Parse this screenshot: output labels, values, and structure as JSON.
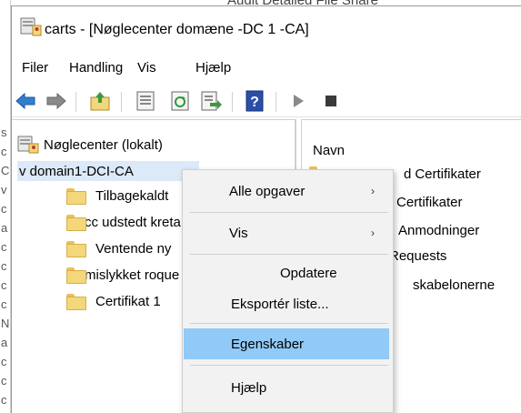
{
  "background": {
    "title_fragment": "Audit Detailed File Share",
    "left_edge_letters": [
      "s",
      "c",
      "C",
      "v",
      "c",
      "a",
      "c",
      "c",
      "c",
      "c",
      "N",
      "a",
      "c",
      "c",
      "c",
      "C"
    ]
  },
  "window": {
    "title": "carts - [Nøglecenter domæne -DC 1 -CA]"
  },
  "menu": {
    "items": [
      "Filer",
      "Handling",
      "Vis",
      "Hjælp"
    ]
  },
  "toolbar": {
    "icons": [
      "back-arrow-icon",
      "forward-arrow-icon",
      "up-folder-icon",
      "properties-sheet-icon",
      "refresh-icon",
      "export-list-icon",
      "help-book-icon",
      "start-service-icon",
      "stop-service-icon"
    ],
    "help_glyph": "?"
  },
  "tree": {
    "root": "Nøglecenter (lokalt)",
    "ca_node": "v domain1-DCI-CA",
    "folders": [
      "Tilbagekaldt",
      "cc udstedt kreta",
      "Ventende ny",
      "mislykket roque",
      "Certifikat 1"
    ]
  },
  "right_pane": {
    "header": "Navn",
    "rows": [
      "Certifikater",
      "Certifikater",
      "Anmodninger",
      "Requests",
      "skabelonerne"
    ],
    "partial_prefix": "d"
  },
  "context_menu": {
    "items": [
      {
        "label": "Alle opgaver",
        "submenu": true
      },
      {
        "label": "Vis",
        "submenu": true
      },
      {
        "label": "Opdatere",
        "submenu": false
      },
      {
        "label": "Eksportér liste...",
        "submenu": false
      },
      {
        "label": "Egenskaber",
        "submenu": false,
        "highlighted": true
      },
      {
        "label": "Hjælp",
        "submenu": false
      }
    ],
    "arrow_glyph": "›"
  },
  "colors": {
    "highlight": "#91c9f7",
    "selection": "#dbe9f8",
    "folder": "#f3d77a",
    "help_blue": "#2b4fa8"
  }
}
